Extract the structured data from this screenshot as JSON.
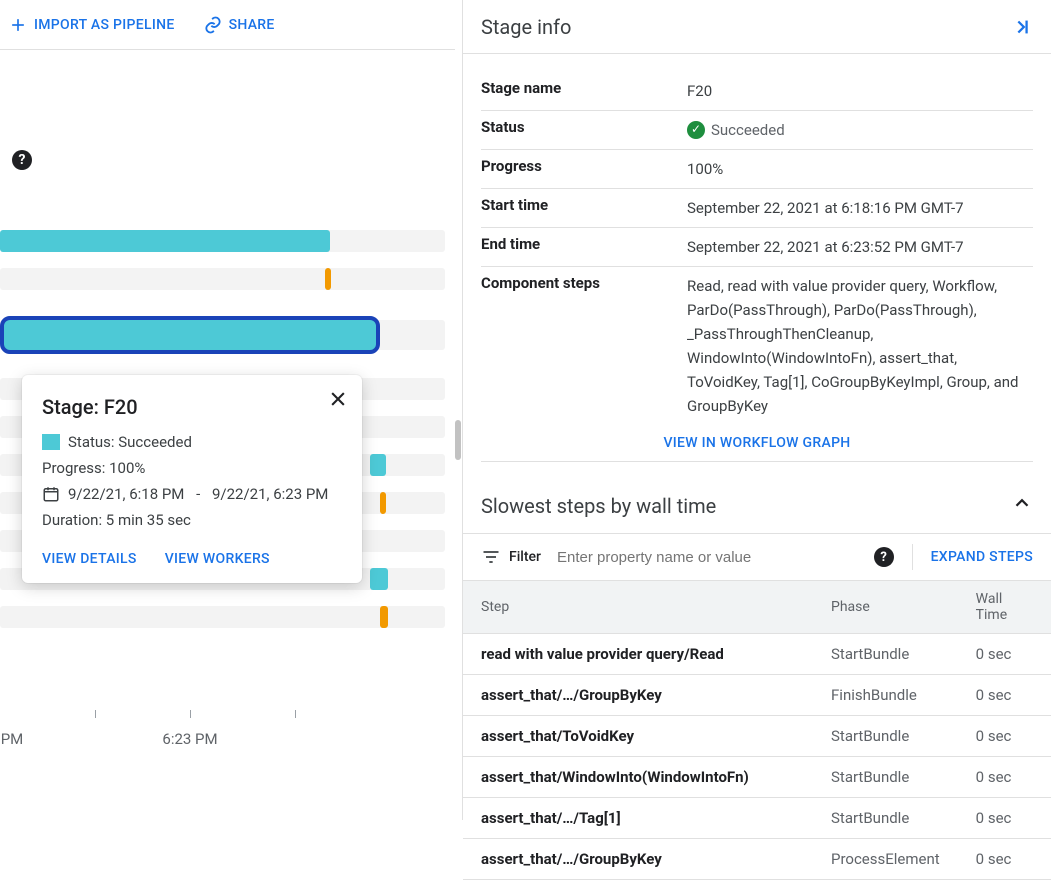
{
  "topbar": {
    "import_label": "IMPORT AS PIPELINE",
    "share_label": "SHARE"
  },
  "tooltip": {
    "title": "Stage: F20",
    "status_label": "Status: Succeeded",
    "progress_label": "Progress: 100%",
    "start": "9/22/21, 6:18 PM",
    "end": "9/22/21, 6:23 PM",
    "duration_label": "Duration: 5 min 35 sec",
    "view_details": "VIEW DETAILS",
    "view_workers": "VIEW WORKERS"
  },
  "axis": {
    "t0": "PM",
    "t1": "6:23 PM"
  },
  "panel": {
    "title": "Stage info",
    "kv": {
      "stage_name_k": "Stage name",
      "stage_name_v": "F20",
      "status_k": "Status",
      "status_v": "Succeeded",
      "progress_k": "Progress",
      "progress_v": "100%",
      "start_k": "Start time",
      "start_v": "September 22, 2021 at 6:18:16 PM GMT-7",
      "end_k": "End time",
      "end_v": "September 22, 2021 at 6:23:52 PM GMT-7",
      "comp_k": "Component steps",
      "comp_v": "Read, read with value provider query, Workflow, ParDo(PassThrough), ParDo(PassThrough), _PassThroughThenCleanup, WindowInto(WindowIntoFn), assert_that, ToVoidKey, Tag[1], CoGroupByKeyImpl, Group, and GroupByKey"
    },
    "view_graph": "VIEW IN WORKFLOW GRAPH",
    "slow_title": "Slowest steps by wall time",
    "filter_label": "Filter",
    "filter_placeholder": "Enter property name or value",
    "expand_steps": "EXPAND STEPS",
    "cols": {
      "step": "Step",
      "phase": "Phase",
      "wall": "Wall Time"
    },
    "rows": [
      {
        "step": "read with value provider query/Read",
        "phase": "StartBundle",
        "wall": "0 sec"
      },
      {
        "step": "assert_that/…/GroupByKey",
        "phase": "FinishBundle",
        "wall": "0 sec"
      },
      {
        "step": "assert_that/ToVoidKey",
        "phase": "StartBundle",
        "wall": "0 sec"
      },
      {
        "step": "assert_that/WindowInto(WindowIntoFn)",
        "phase": "StartBundle",
        "wall": "0 sec"
      },
      {
        "step": "assert_that/…/Tag[1]",
        "phase": "StartBundle",
        "wall": "0 sec"
      },
      {
        "step": "assert_that/…/GroupByKey",
        "phase": "ProcessElement",
        "wall": "0 sec"
      }
    ]
  }
}
